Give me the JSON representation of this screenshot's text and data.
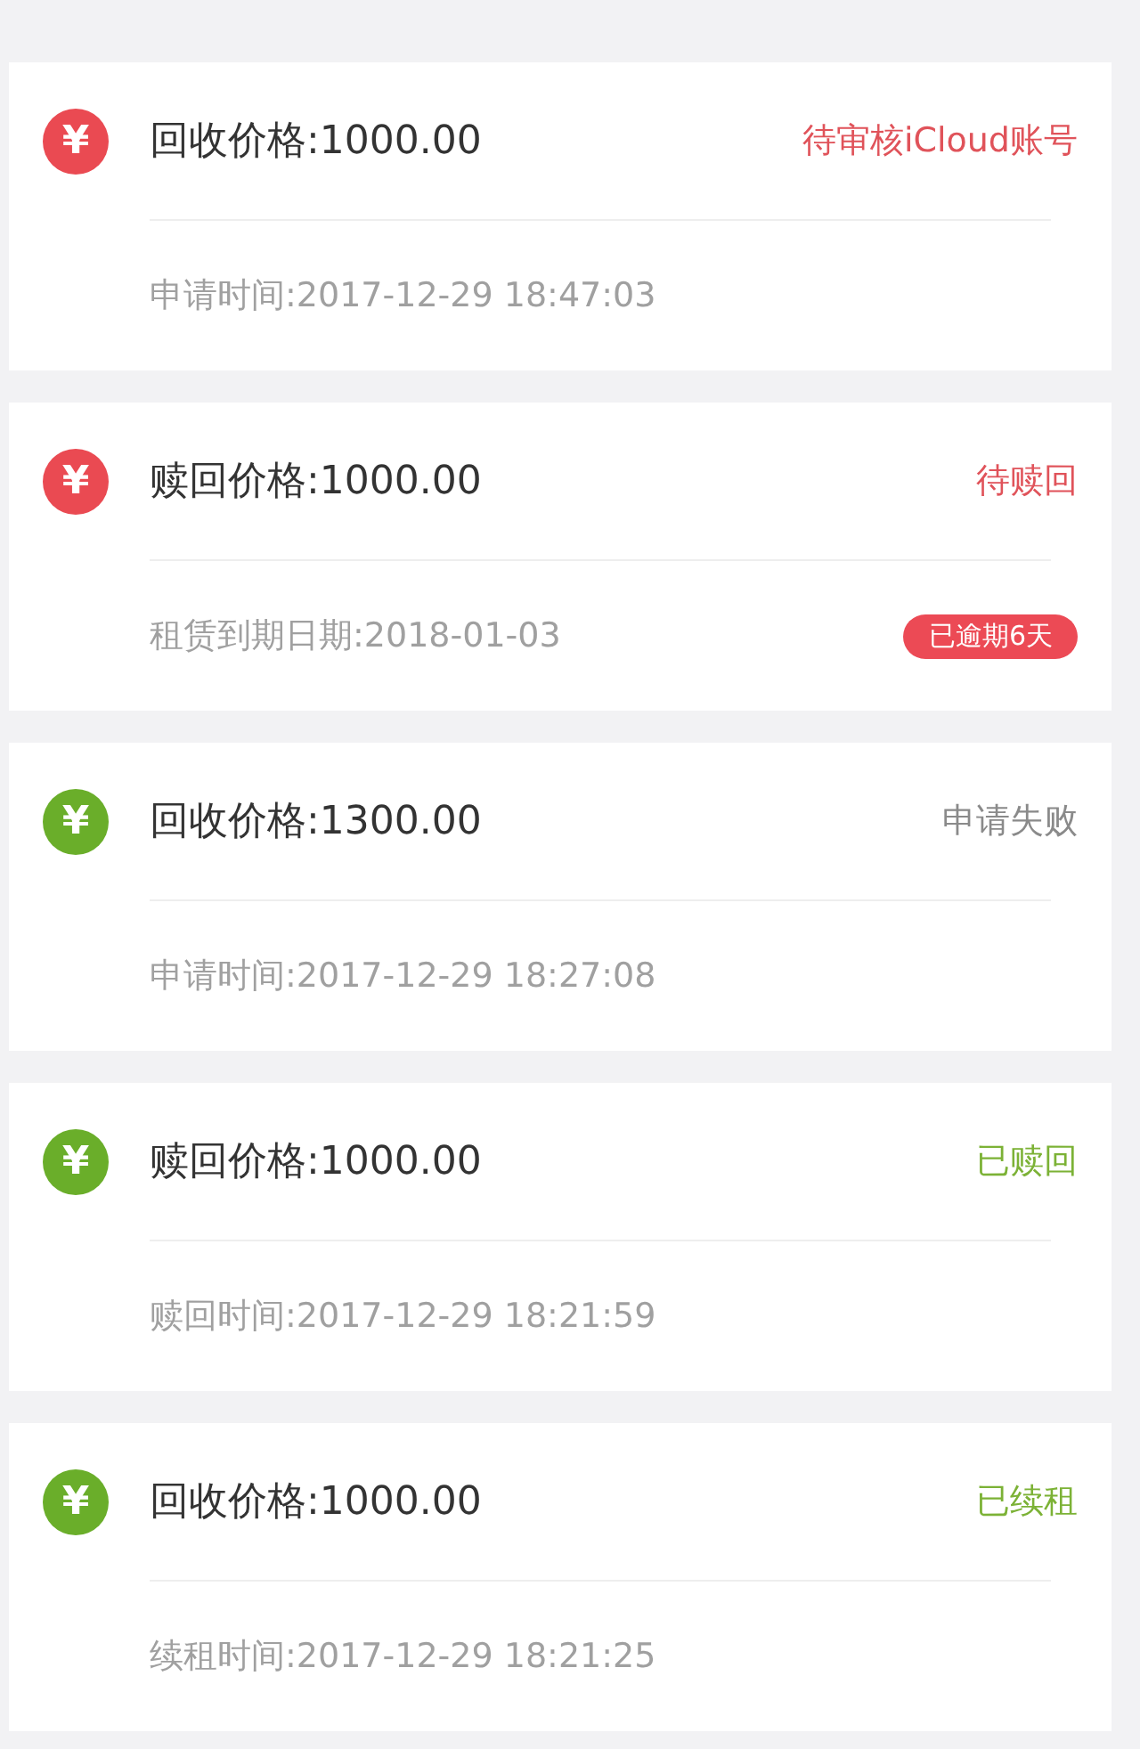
{
  "records": [
    {
      "color": "#ea4a52",
      "icon": "¥",
      "title": "回收价格:1000.00",
      "status": {
        "text": "待审核iCloud账号",
        "color": "#e0535a"
      },
      "detail": "申请时间:2017-12-29 18:47:03"
    },
    {
      "color": "#ea4a52",
      "icon": "¥",
      "title": "赎回价格:1000.00",
      "status": {
        "text": "待赎回",
        "color": "#e0535a"
      },
      "detail": "租赁到期日期:2018-01-03",
      "badge": "已逾期6天"
    },
    {
      "color": "#6aae2a",
      "icon": "¥",
      "title": "回收价格:1300.00",
      "status": {
        "text": "申请失败",
        "color": "#8a8a8a"
      },
      "detail": "申请时间:2017-12-29 18:27:08"
    },
    {
      "color": "#6aae2a",
      "icon": "¥",
      "title": "赎回价格:1000.00",
      "status": {
        "text": "已赎回",
        "color": "#7cb236"
      },
      "detail": "赎回时间:2017-12-29 18:21:59"
    },
    {
      "color": "#6aae2a",
      "icon": "¥",
      "title": "回收价格:1000.00",
      "status": {
        "text": "已续租",
        "color": "#7cb236"
      },
      "detail": "续租时间:2017-12-29 18:21:25"
    }
  ]
}
